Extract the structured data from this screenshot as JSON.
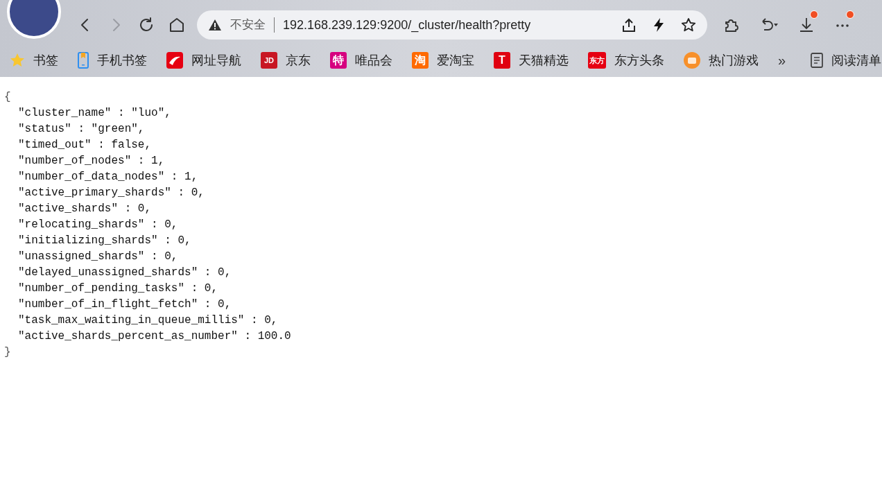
{
  "toolbar": {
    "back": {
      "disabled": false
    },
    "forward": {
      "disabled": true
    }
  },
  "address_bar": {
    "security": "不安全",
    "url": "192.168.239.129:9200/_cluster/health?pretty"
  },
  "extensions": [
    {
      "kind": "puzzle",
      "notify": false
    },
    {
      "kind": "undo",
      "notify": false
    },
    {
      "kind": "download",
      "notify": true
    },
    {
      "kind": "more",
      "notify": true
    }
  ],
  "bookmarks": [
    {
      "label": "书签",
      "kind": "star"
    },
    {
      "label": "手机书签",
      "kind": "phone"
    },
    {
      "label": "网址导航",
      "kind": "swoosh",
      "color": "#e60012"
    },
    {
      "label": "京东",
      "kind": "badge",
      "badge": "JD",
      "color": "#c81623"
    },
    {
      "label": "唯品会",
      "kind": "badge",
      "badge": "特",
      "color": "#d6007f"
    },
    {
      "label": "爱淘宝",
      "kind": "badge",
      "badge": "淘",
      "color": "#ff6a00"
    },
    {
      "label": "天猫精选",
      "kind": "badge",
      "badge": "T",
      "color": "#e00010"
    },
    {
      "label": "东方头条",
      "kind": "badge",
      "badge": "东方",
      "color": "#e60012"
    },
    {
      "label": "热门游戏",
      "kind": "game",
      "color": "#f7902a"
    }
  ],
  "overflow": "»",
  "reading_list": "阅读清单",
  "content": {
    "open": "{",
    "lines": [
      "\"cluster_name\" : \"luo\",",
      "\"status\" : \"green\",",
      "\"timed_out\" : false,",
      "\"number_of_nodes\" : 1,",
      "\"number_of_data_nodes\" : 1,",
      "\"active_primary_shards\" : 0,",
      "\"active_shards\" : 0,",
      "\"relocating_shards\" : 0,",
      "\"initializing_shards\" : 0,",
      "\"unassigned_shards\" : 0,",
      "\"delayed_unassigned_shards\" : 0,",
      "\"number_of_pending_tasks\" : 0,",
      "\"number_of_in_flight_fetch\" : 0,",
      "\"task_max_waiting_in_queue_millis\" : 0,",
      "\"active_shards_percent_as_number\" : 100.0"
    ],
    "close": "}"
  }
}
